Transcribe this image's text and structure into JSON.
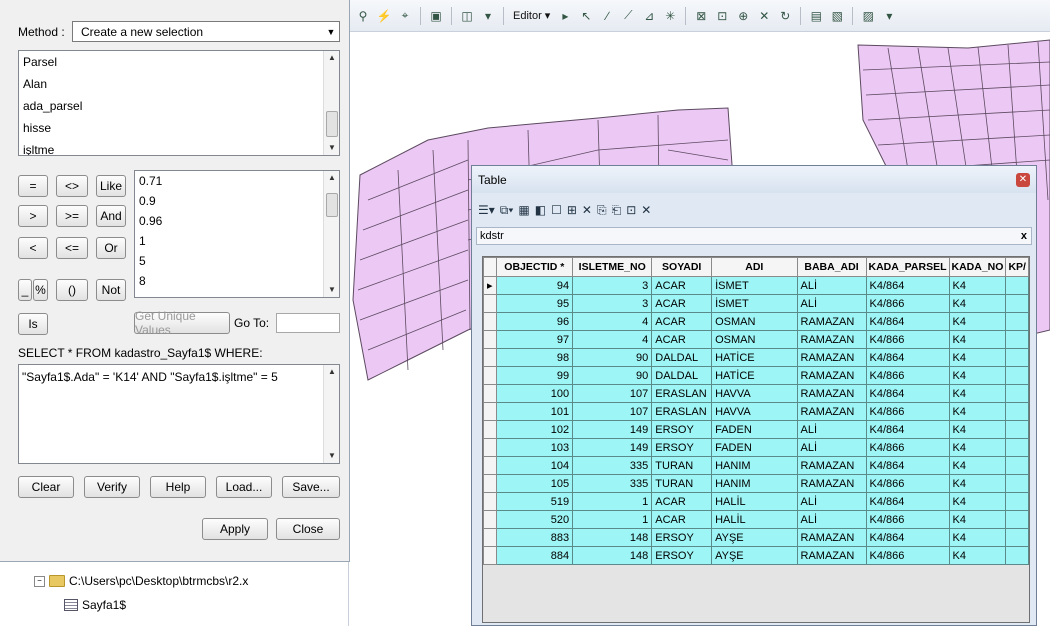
{
  "dialog": {
    "method_label": "Method :",
    "method_value": "Create a new selection",
    "fields": [
      "Parsel",
      "Alan",
      "ada_parsel",
      "hisse",
      "işltme"
    ],
    "operators": [
      "=",
      "<>",
      "Like",
      ">",
      ">=",
      "And",
      "<",
      "<=",
      "Or",
      "_",
      "%",
      "()",
      "Not",
      "Is"
    ],
    "values": [
      "0.71",
      "0.9",
      "0.96",
      "1",
      "5",
      "8"
    ],
    "get_unique_label": "Get Unique Values",
    "goto_label": "Go To:",
    "select_clause": "SELECT * FROM kadastro_Sayfa1$ WHERE:",
    "expression": "\"Sayfa1$.Ada\" = 'K14' AND \"Sayfa1$.işltme\" = 5",
    "buttons": {
      "clear": "Clear",
      "verify": "Verify",
      "help": "Help",
      "load": "Load...",
      "save": "Save...",
      "apply": "Apply",
      "close": "Close"
    }
  },
  "toc": {
    "path": "C:\\Users\\pc\\Desktop\\btrmcbs\\r2.x",
    "table": "Sayfa1$",
    "expander": "−"
  },
  "toolbar": {
    "editor_label": "Editor ▾"
  },
  "table_window": {
    "title": "Table",
    "layer_tab": "kdstr",
    "close_tab": "x",
    "columns": [
      "OBJECTID *",
      "ISLETME_NO",
      "SOYADI",
      "ADI",
      "BABA_ADI",
      "KADA_PARSEL",
      "KADA_NO",
      "KP/"
    ],
    "rows": [
      [
        "94",
        "3",
        "ACAR",
        "İSMET",
        "ALİ",
        "K4/864",
        "K4"
      ],
      [
        "95",
        "3",
        "ACAR",
        "İSMET",
        "ALİ",
        "K4/866",
        "K4"
      ],
      [
        "96",
        "4",
        "ACAR",
        "OSMAN",
        "RAMAZAN",
        "K4/864",
        "K4"
      ],
      [
        "97",
        "4",
        "ACAR",
        "OSMAN",
        "RAMAZAN",
        "K4/866",
        "K4"
      ],
      [
        "98",
        "90",
        "DALDAL",
        "HATİCE",
        "RAMAZAN",
        "K4/864",
        "K4"
      ],
      [
        "99",
        "90",
        "DALDAL",
        "HATİCE",
        "RAMAZAN",
        "K4/866",
        "K4"
      ],
      [
        "100",
        "107",
        "ERASLAN",
        "HAVVA",
        "RAMAZAN",
        "K4/864",
        "K4"
      ],
      [
        "101",
        "107",
        "ERASLAN",
        "HAVVA",
        "RAMAZAN",
        "K4/866",
        "K4"
      ],
      [
        "102",
        "149",
        "ERSOY",
        "FADEN",
        "ALİ",
        "K4/864",
        "K4"
      ],
      [
        "103",
        "149",
        "ERSOY",
        "FADEN",
        "ALİ",
        "K4/866",
        "K4"
      ],
      [
        "104",
        "335",
        "TURAN",
        "HANIM",
        "RAMAZAN",
        "K4/864",
        "K4"
      ],
      [
        "105",
        "335",
        "TURAN",
        "HANIM",
        "RAMAZAN",
        "K4/866",
        "K4"
      ],
      [
        "519",
        "1",
        "ACAR",
        "HALİL",
        "ALİ",
        "K4/864",
        "K4"
      ],
      [
        "520",
        "1",
        "ACAR",
        "HALİL",
        "ALİ",
        "K4/866",
        "K4"
      ],
      [
        "883",
        "148",
        "ERSOY",
        "AYŞE",
        "RAMAZAN",
        "K4/864",
        "K4"
      ],
      [
        "884",
        "148",
        "ERSOY",
        "AYŞE",
        "RAMAZAN",
        "K4/866",
        "K4"
      ]
    ]
  },
  "colors": {
    "parcel_fill": "#ecc8f4",
    "parcel_stroke": "#5c4a60",
    "row_fill": "#9ef5f5"
  }
}
